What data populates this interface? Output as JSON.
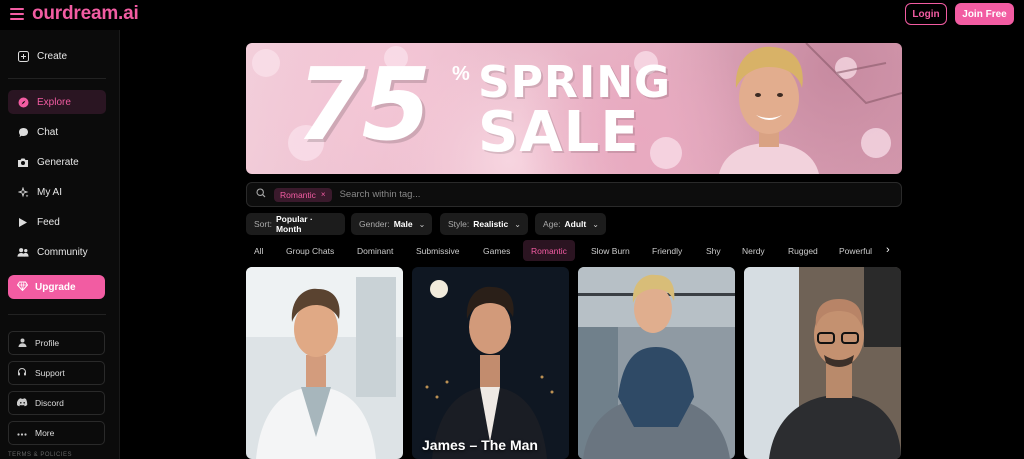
{
  "header": {
    "logo": "ourdream.ai",
    "login_label": "Login",
    "join_label": "Join Free",
    "brand_color": "#f25ca2"
  },
  "sidebar": {
    "create": {
      "label": "Create",
      "icon": "plus-square-icon"
    },
    "items": [
      {
        "label": "Explore",
        "icon": "compass-icon",
        "active": true
      },
      {
        "label": "Chat",
        "icon": "chat-bubble-icon"
      },
      {
        "label": "Generate",
        "icon": "camera-icon"
      },
      {
        "label": "My AI",
        "icon": "sparkle-icon"
      },
      {
        "label": "Feed",
        "icon": "play-icon"
      },
      {
        "label": "Community",
        "icon": "users-icon"
      }
    ],
    "upgrade_label": "Upgrade",
    "bottom": [
      {
        "label": "Profile",
        "icon": "user-icon"
      },
      {
        "label": "Support",
        "icon": "headset-icon"
      },
      {
        "label": "Discord",
        "icon": "discord-icon"
      },
      {
        "label": "More",
        "icon": "ellipsis-icon"
      }
    ],
    "terms": "TERMS & POLICIES"
  },
  "banner": {
    "number": "75",
    "percent": "%",
    "line1": "SPRING",
    "line2": "SALE"
  },
  "search": {
    "tag": "Romantic",
    "placeholder": "Search within tag..."
  },
  "filters": [
    {
      "label": "Sort:",
      "value": "Popular · Month"
    },
    {
      "label": "Gender:",
      "value": "Male"
    },
    {
      "label": "Style:",
      "value": "Realistic"
    },
    {
      "label": "Age:",
      "value": "Adult"
    }
  ],
  "tags": [
    "All",
    "Group Chats",
    "Dominant",
    "Submissive",
    "Games",
    "Romantic",
    "Slow Burn",
    "Friendly",
    "Shy",
    "Nerdy",
    "Rugged",
    "Powerful"
  ],
  "active_tag": "Romantic",
  "cards": [
    {
      "name": ""
    },
    {
      "name": "James – The Man"
    },
    {
      "name": ""
    },
    {
      "name": ""
    }
  ]
}
